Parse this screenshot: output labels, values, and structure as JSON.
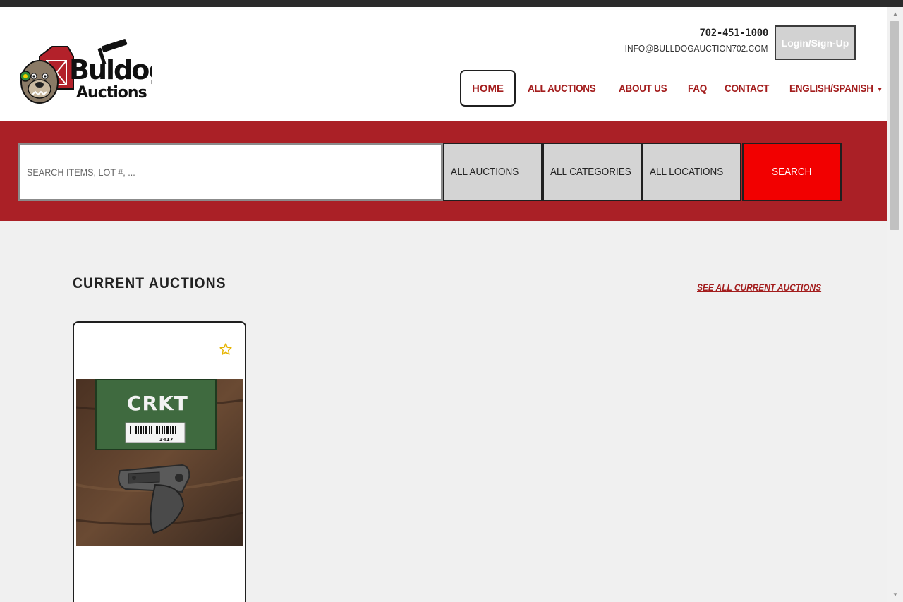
{
  "header": {
    "logo": {
      "word1": "Buldog",
      "word2": "Auctions"
    },
    "phone": "702-451-1000",
    "email": "INFO@BULLDOGAUCTION702.COM",
    "login_label": "Login/Sign-Up",
    "nav": [
      {
        "label": "HOME"
      },
      {
        "label": "ALL AUCTIONS"
      },
      {
        "label": "ABOUT US"
      },
      {
        "label": "FAQ"
      },
      {
        "label": "CONTACT"
      },
      {
        "label": "ENGLISH/SPANISH"
      }
    ],
    "language_caret_icon": "caret-down-icon"
  },
  "search": {
    "placeholder": "SEARCH ITEMS, LOT #, ...",
    "filters": [
      {
        "label": "ALL AUCTIONS"
      },
      {
        "label": "ALL CATEGORIES"
      },
      {
        "label": "ALL LOCATIONS"
      }
    ],
    "button_label": "SEARCH"
  },
  "current_auctions": {
    "title": "CURRENT AUCTIONS",
    "see_all": "SEE ALL CURRENT AUCTIONS",
    "cards": [
      {
        "favorite_icon": "star-outline-icon",
        "image_brand": "CRKT",
        "image_lot": "3417"
      }
    ]
  },
  "colors": {
    "brand_red": "#aa2026",
    "search_red": "#f20000",
    "nav_text": "#a31d1d",
    "star": "#e6b400"
  }
}
